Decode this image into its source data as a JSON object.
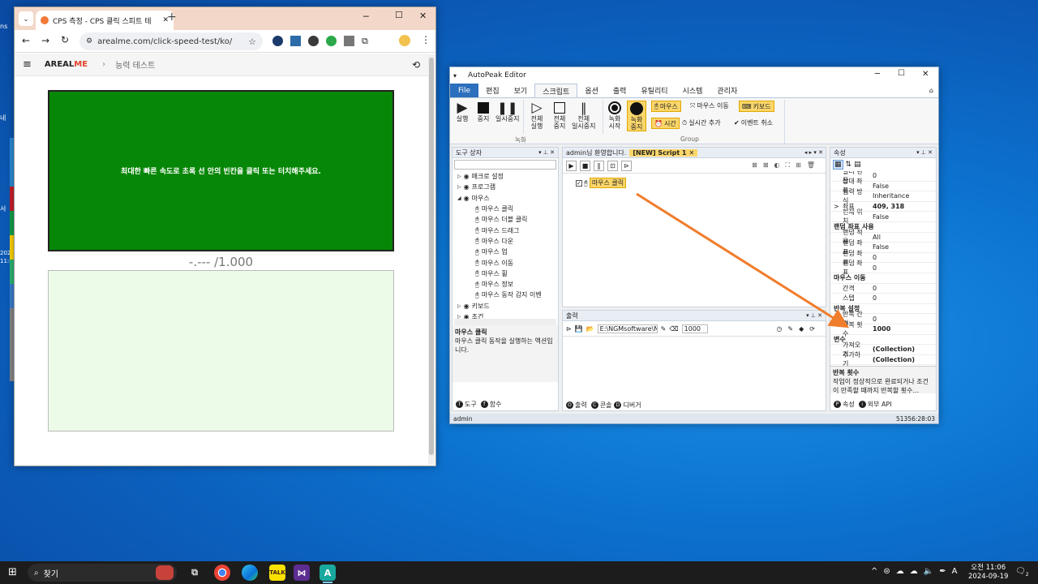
{
  "chrome": {
    "tab_title": "CPS 측정 - CPS 클릭 스피트 테",
    "url": "arealme.com/click-speed-test/ko/",
    "brand_a": "AREAL",
    "brand_b": "ME",
    "breadcrumb": "능력 테스트",
    "instruction": "최대한 빠른 속도로 초록 선 안의 빈칸을 클릭 또는 터치해주세요.",
    "score": "-.--- /1.000"
  },
  "autopeak": {
    "title": "AutoPeak Editor",
    "menu": [
      "File",
      "편집",
      "보기",
      "스크립트",
      "옵션",
      "출력",
      "유틸리티",
      "시스템",
      "관리자"
    ],
    "ribbon": {
      "run": "실행",
      "stop": "중지",
      "pause": "일시중지",
      "all_run": "전체\n실행",
      "all_stop": "전체\n중지",
      "all_pause": "전체\n일시중지",
      "rec_start": "녹화\n시작",
      "rec_stop": "녹화\n중지",
      "mouse": "마우스",
      "mouse_move": "마우스 이동",
      "keyboard": "키보드",
      "time": "시간",
      "add_realtime": "실시간 추가",
      "cancel_event": "이벤트 취소",
      "group_record": "녹화",
      "group_group": "Group"
    },
    "toolbox": {
      "title": "도구 상자",
      "items": [
        {
          "label": "매크로 설정",
          "level": 0,
          "exp": "▷"
        },
        {
          "label": "프로그램",
          "level": 0,
          "exp": "▷"
        },
        {
          "label": "마우스",
          "level": 0,
          "exp": "◢"
        },
        {
          "label": "마우스 클릭",
          "level": 1
        },
        {
          "label": "마우스 더블 클릭",
          "level": 1
        },
        {
          "label": "마우스 드래그",
          "level": 1
        },
        {
          "label": "마우스 다운",
          "level": 1
        },
        {
          "label": "마우스 업",
          "level": 1
        },
        {
          "label": "마우스 이동",
          "level": 1
        },
        {
          "label": "마우스 휠",
          "level": 1
        },
        {
          "label": "마우스 정보",
          "level": 1
        },
        {
          "label": "마우스 동작 감지 이벤",
          "level": 1
        },
        {
          "label": "키보드",
          "level": 0,
          "exp": "▷"
        },
        {
          "label": "조건",
          "level": 0,
          "exp": "▷"
        },
        {
          "label": "시간",
          "level": 0,
          "exp": "▷"
        }
      ],
      "desc_title": "마우스 클릭",
      "desc_text": "마우스 클릭 동작을 실행하는 액션입니다.",
      "tab_tools": "도구",
      "tab_functions": "함수"
    },
    "editor": {
      "tab_welcome": "admin님 환영합니다.",
      "tab_script": "[NEW] Script 1",
      "node_label": "마우스 클릭"
    },
    "output": {
      "title": "출력",
      "path": "E:\\NGMsoftware\\NG",
      "count": "1000",
      "tab_output": "출력",
      "tab_console": "콘솔",
      "tab_debugger": "디버거"
    },
    "properties": {
      "title": "속성",
      "rows": [
        {
          "k": "멀티 핸들",
          "v": "0"
        },
        {
          "k": "상대 좌표",
          "v": "False"
        },
        {
          "k": "입력 방식",
          "v": "Inheritance"
        },
        {
          "k": "좌표",
          "v": "409, 318",
          "bold": true,
          "exp": ">"
        },
        {
          "k": "현재 위치",
          "v": "False"
        },
        {
          "k": "랜덤 좌표 사용",
          "v": "",
          "cat": true
        },
        {
          "k": "랜덤 적용",
          "v": "All"
        },
        {
          "k": "랜덤 좌표",
          "v": "False"
        },
        {
          "k": "랜덤 좌표",
          "v": "0"
        },
        {
          "k": "랜덤 좌표",
          "v": "0"
        },
        {
          "k": "마우스 이동",
          "v": "",
          "cat": true
        },
        {
          "k": "간격",
          "v": "0"
        },
        {
          "k": "스텝",
          "v": "0"
        },
        {
          "k": "반복 설정",
          "v": "",
          "cat": true
        },
        {
          "k": "반복 간격",
          "v": "0"
        },
        {
          "k": "반복 횟수",
          "v": "1000",
          "bold": true
        },
        {
          "k": "변수",
          "v": "",
          "cat": true
        },
        {
          "k": "가져오기",
          "v": "(Collection)",
          "bold": true
        },
        {
          "k": "추가하기",
          "v": "(Collection)",
          "bold": true
        }
      ],
      "desc_title": "반복 횟수",
      "desc_text": "작업이 정상적으로 완료되거나 조건이 만족할 때까지 반복할 횟수...",
      "tab_props": "속성",
      "tab_api": "외부 API"
    },
    "status_user": "admin",
    "status_right": "51356:28:03"
  },
  "desktop": {
    "left_labels": [
      "ns",
      "네",
      "서",
      "202",
      "11:0"
    ]
  },
  "taskbar": {
    "search": "찾기",
    "time": "오전 11:06",
    "date": "2024-09-19",
    "ime": "A",
    "notif": "2"
  }
}
